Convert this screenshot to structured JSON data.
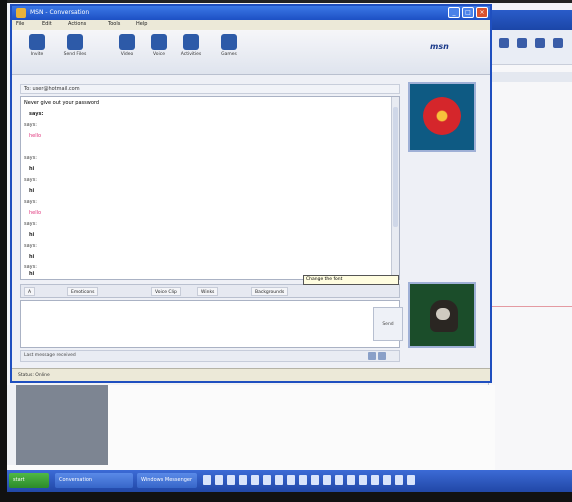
{
  "window": {
    "title": "MSN - Conversation",
    "menu": [
      "File",
      "Edit",
      "Actions",
      "Tools",
      "Help"
    ],
    "toolbar": [
      {
        "label": "Invite",
        "icon": "invite-icon"
      },
      {
        "label": "Send Files",
        "icon": "send-files-icon"
      },
      {
        "label": "Video",
        "icon": "video-icon"
      },
      {
        "label": "Voice",
        "icon": "voice-icon"
      },
      {
        "label": "Activities",
        "icon": "activities-icon"
      },
      {
        "label": "Games",
        "icon": "games-icon"
      }
    ],
    "brand": "msn",
    "to_line": "To: user@hotmail.com",
    "messages": [
      {
        "text": "Never give out your password",
        "style": "sender"
      },
      {
        "text": "says:",
        "style": "body-dark"
      },
      {
        "text": "says:",
        "style": "sender"
      },
      {
        "text": "hello",
        "style": "body-red"
      },
      {
        "text": "says:",
        "style": "sender"
      },
      {
        "text": "hi",
        "style": "body-dark"
      },
      {
        "text": "says:",
        "style": "sender"
      },
      {
        "text": "hi",
        "style": "body-dark"
      },
      {
        "text": "says:",
        "style": "sender"
      },
      {
        "text": "hello",
        "style": "body-red"
      },
      {
        "text": "says:",
        "style": "sender"
      },
      {
        "text": "hi",
        "style": "body-dark"
      },
      {
        "text": "says:",
        "style": "sender"
      },
      {
        "text": "hi",
        "style": "body-dark"
      },
      {
        "text": "says:",
        "style": "sender"
      },
      {
        "text": "hi",
        "style": "body-dark"
      }
    ],
    "format_buttons": [
      "A",
      "Emoticons",
      "Voice Clip",
      "Winks",
      "Backgrounds"
    ],
    "tooltip": "Change the font",
    "send_label": "Send",
    "status_inner": "Last message received",
    "statusbar": "Status: Online"
  },
  "taskbar": {
    "start_label": "start",
    "tasks": [
      "Conversation",
      "Windows Messenger"
    ]
  }
}
